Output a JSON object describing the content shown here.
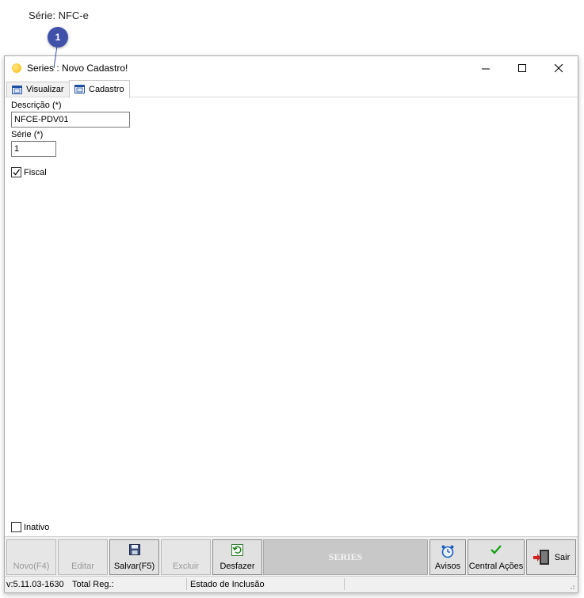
{
  "caption": "Série: NFC-e",
  "badge": "1",
  "window": {
    "title": "Series : Novo Cadastro!",
    "controls": {
      "minimize": "minimize-icon",
      "maximize": "maximize-icon",
      "close": "close-icon"
    }
  },
  "tabs": [
    {
      "label": "Visualizar"
    },
    {
      "label": "Cadastro"
    }
  ],
  "form": {
    "descricao_label": "Descrição (*)",
    "descricao_value": "NFCE-PDV01",
    "serie_label": "Série (*)",
    "serie_value": "1",
    "fiscal_label": "Fiscal",
    "fiscal_checked": true,
    "inativo_label": "Inativo",
    "inativo_checked": false
  },
  "toolbar": {
    "novo": "Novo(F4)",
    "editar": "Editar",
    "salvar": "Salvar(F5)",
    "excluir": "Excluir",
    "desfazer": "Desfazer",
    "banner": "SERIES",
    "avisos": "Avisos",
    "central": "Central Ações",
    "sair": "Sair"
  },
  "status": {
    "version": "v:5.11.03-1630",
    "total": "Total Reg.:",
    "estado": "Estado de Inclusão"
  },
  "colors": {
    "badge": "#3f51a8",
    "check_green": "#1aa31a"
  }
}
